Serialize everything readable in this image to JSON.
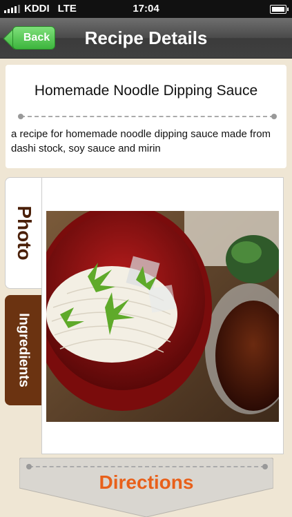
{
  "status_bar": {
    "carrier": "KDDI",
    "network": "LTE",
    "time": "17:04",
    "icons": [
      "signal-icon",
      "battery-icon"
    ]
  },
  "nav": {
    "back_label": "Back",
    "title": "Recipe Details"
  },
  "recipe": {
    "title": "Homemade Noodle Dipping Sauce",
    "description": "a recipe for homemade noodle dipping sauce made from dashi stock, soy sauce and mirin"
  },
  "tabs": [
    {
      "label": "Photo",
      "selected": true
    },
    {
      "label": "Ingredients",
      "selected": false
    }
  ],
  "directions": {
    "label": "Directions"
  },
  "colors": {
    "back_green": "#3db53d",
    "tab_brown": "#6b3311",
    "directions_orange": "#e8601a"
  }
}
